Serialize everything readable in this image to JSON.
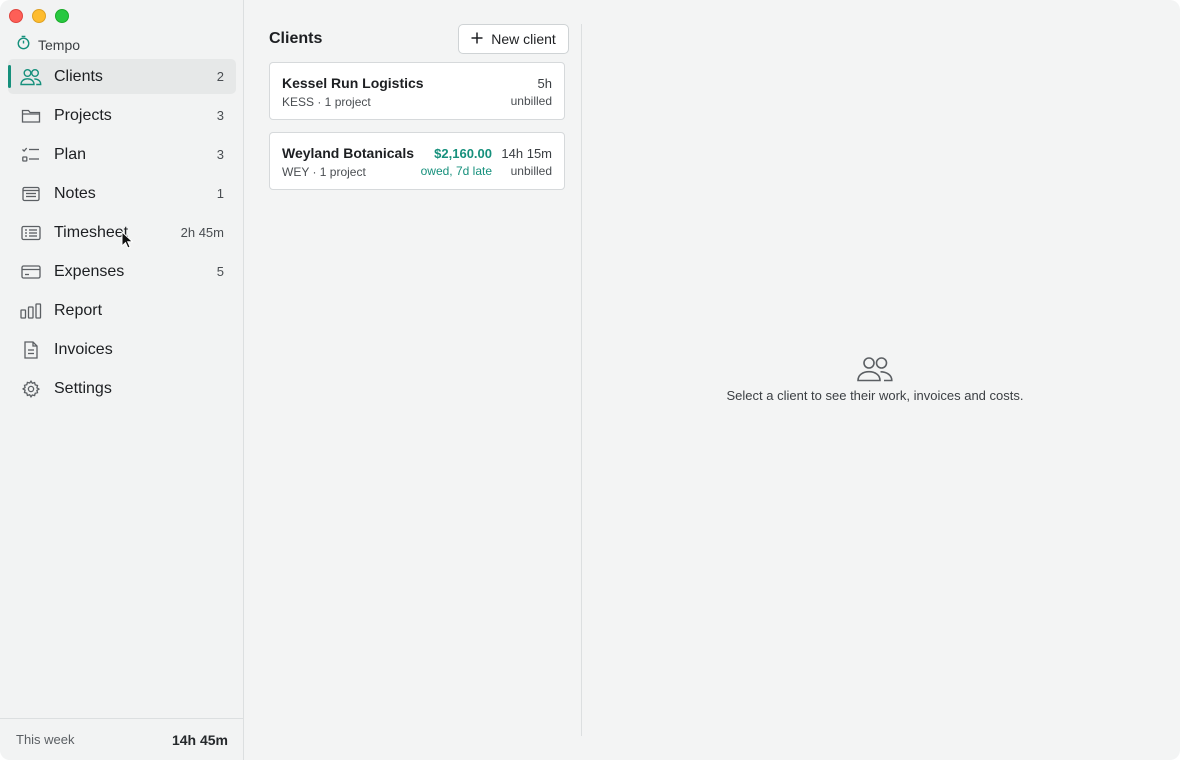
{
  "app": {
    "name": "Tempo"
  },
  "sidebar": {
    "items": [
      {
        "label": "Clients",
        "count": "2",
        "icon": "clients-icon"
      },
      {
        "label": "Projects",
        "count": "3",
        "icon": "folder-icon"
      },
      {
        "label": "Plan",
        "count": "3",
        "icon": "checklist-icon"
      },
      {
        "label": "Notes",
        "count": "1",
        "icon": "notes-icon"
      },
      {
        "label": "Timesheet",
        "count": "2h 45m",
        "icon": "timesheet-icon"
      },
      {
        "label": "Expenses",
        "count": "5",
        "icon": "card-icon"
      },
      {
        "label": "Report",
        "count": "",
        "icon": "bar-chart-icon"
      },
      {
        "label": "Invoices",
        "count": "",
        "icon": "document-icon"
      },
      {
        "label": "Settings",
        "count": "",
        "icon": "gear-icon"
      }
    ],
    "footer": {
      "label": "This week",
      "value": "14h 45m"
    }
  },
  "list": {
    "title": "Clients",
    "new_button": "New client",
    "clients": [
      {
        "name": "Kessel Run Logistics",
        "sub": "KESS · 1 project",
        "hours": "5h",
        "unbilled": "unbilled",
        "owed": "",
        "owed_note": ""
      },
      {
        "name": "Weyland Botanicals",
        "sub": "WEY · 1 project",
        "hours": "14h 15m",
        "unbilled": "unbilled",
        "owed": "$2,160.00",
        "owed_note": "owed, 7d late"
      }
    ]
  },
  "detail": {
    "empty_text": "Select a client to see their work, invoices and costs."
  },
  "colors": {
    "accent": "#16907c",
    "sidebar_bg": "#f2f3f3",
    "pane_bg": "#f3f4f4"
  }
}
